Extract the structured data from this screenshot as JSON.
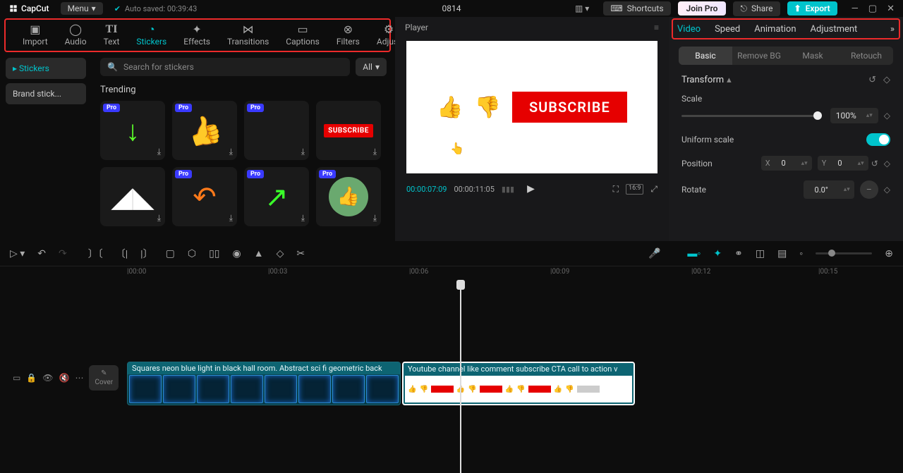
{
  "app": {
    "name": "CapCut",
    "menu": "Menu",
    "autosaved": "Auto saved: 00:39:43",
    "project": "0814"
  },
  "topbar": {
    "shortcuts": "Shortcuts",
    "joinpro": "Join Pro",
    "share": "Share",
    "export": "Export"
  },
  "tabs": [
    "Import",
    "Audio",
    "Text",
    "Stickers",
    "Effects",
    "Transitions",
    "Captions",
    "Filters",
    "Adjust"
  ],
  "activeTab": "Stickers",
  "sideCats": {
    "stickers": "Stickers",
    "brand": "Brand stick..."
  },
  "search": {
    "placeholder": "Search for stickers",
    "all": "All"
  },
  "section": "Trending",
  "stickers": {
    "pro": "Pro",
    "subscribe": "SUBSCRIBE"
  },
  "player": {
    "label": "Player",
    "tcur": "00:00:07:09",
    "ttotal": "00:00:11:05",
    "ar": "16:9",
    "subscribe": "SUBSCRIBE"
  },
  "propTabs": [
    "Video",
    "Speed",
    "Animation",
    "Adjustment"
  ],
  "activePropTab": "Video",
  "subTabs": [
    "Basic",
    "Remove BG",
    "Mask",
    "Retouch"
  ],
  "activeSubTab": "Basic",
  "transform": {
    "title": "Transform",
    "scale": "Scale",
    "scaleVal": "100%",
    "uniform": "Uniform scale",
    "position": "Position",
    "x": "X",
    "xv": "0",
    "y": "Y",
    "yv": "0",
    "rotate": "Rotate",
    "rotVal": "0.0°"
  },
  "ruler": [
    "|00:00",
    "|00:03",
    "|00:06",
    "|00:09",
    "|00:12",
    "|00:15"
  ],
  "clips": {
    "c1": "Squares neon blue light in black hall room. Abstract sci fi geometric back",
    "c2": "Youtube channel like comment subscribe CTA call to action v"
  },
  "cover": "Cover"
}
